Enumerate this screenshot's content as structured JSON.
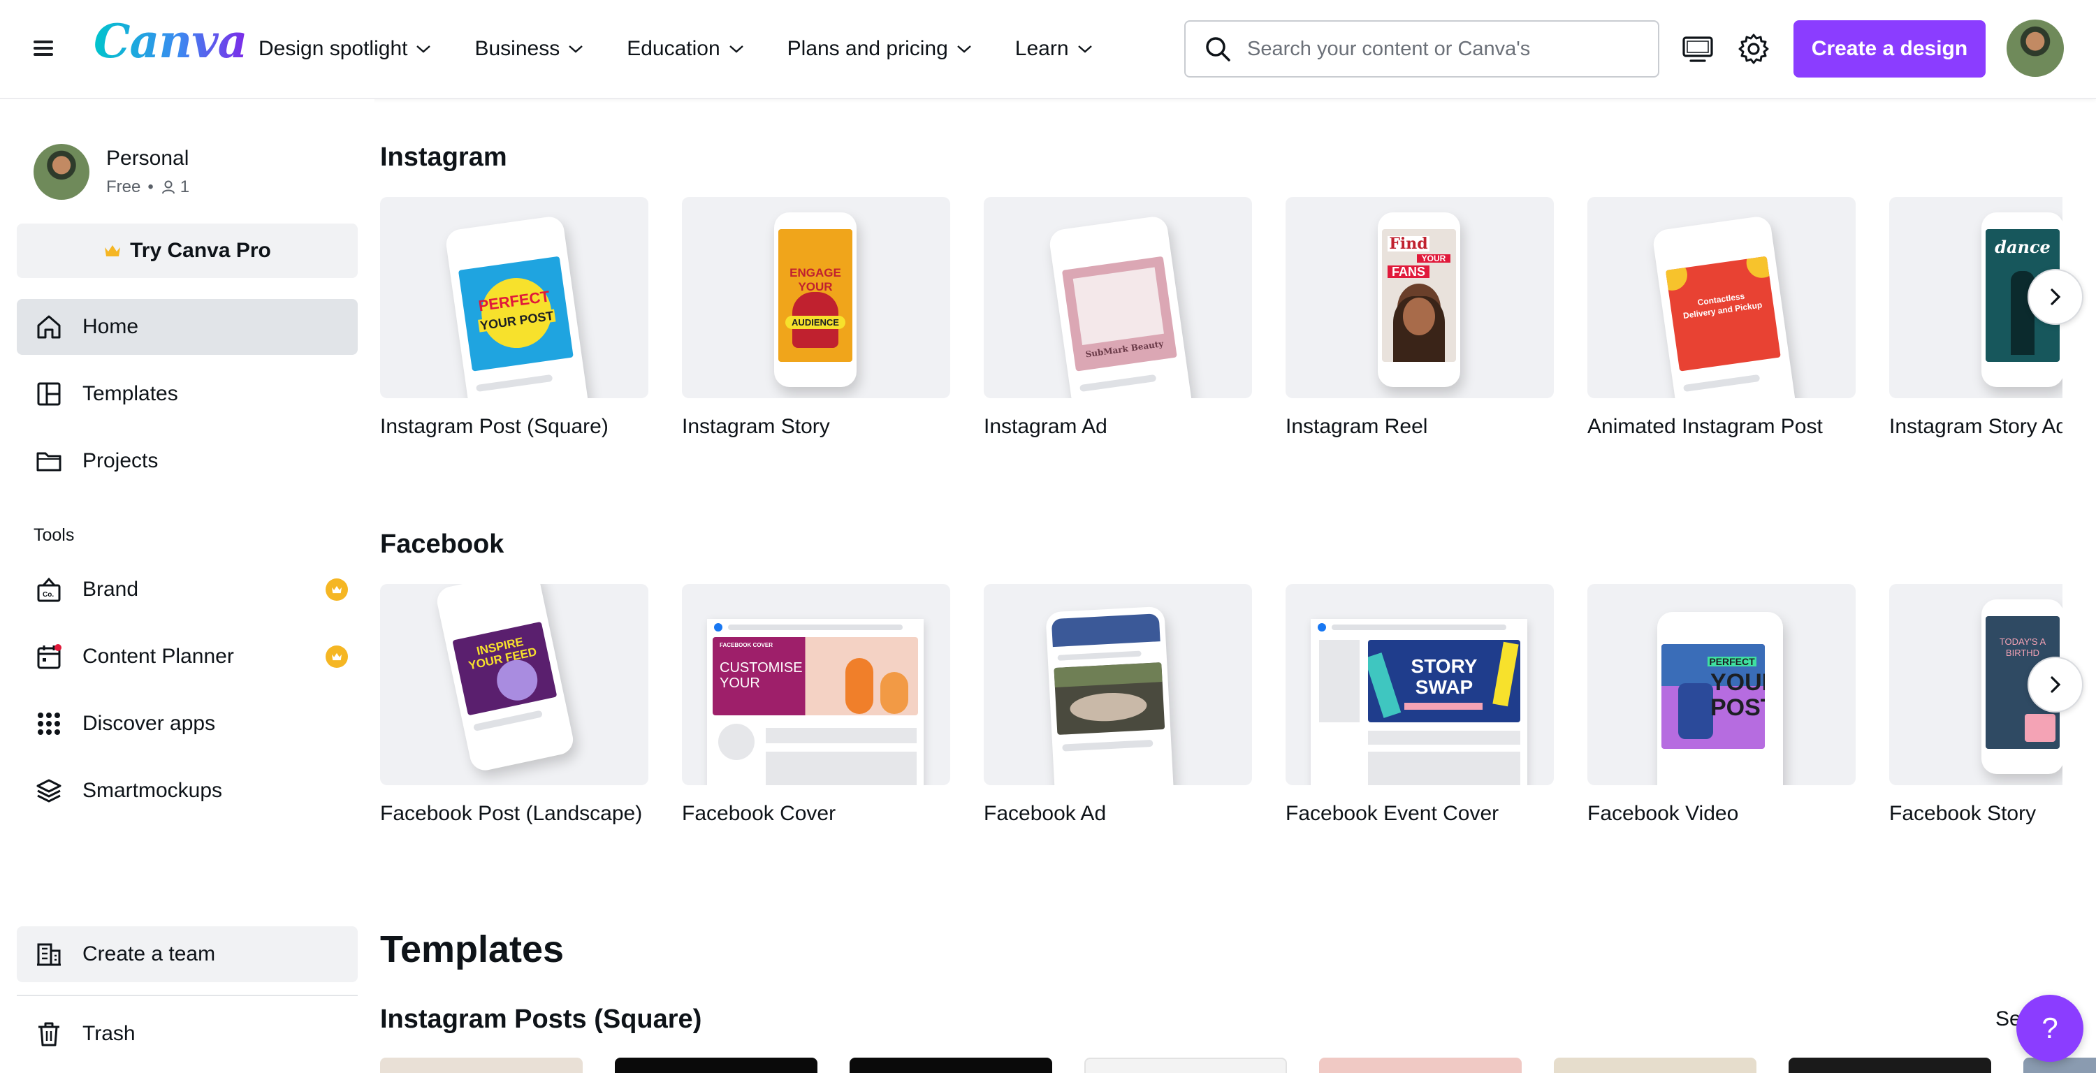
{
  "header": {
    "logo": "Canva",
    "nav": [
      "Design spotlight",
      "Business",
      "Education",
      "Plans and pricing",
      "Learn"
    ],
    "search_placeholder": "Search your content or Canva's",
    "create_button": "Create a design"
  },
  "sidebar": {
    "profile_name": "Personal",
    "profile_plan": "Free",
    "profile_members": "1",
    "try_pro": "Try Canva Pro",
    "nav": [
      {
        "label": "Home",
        "icon": "home-icon",
        "active": true
      },
      {
        "label": "Templates",
        "icon": "templates-icon"
      },
      {
        "label": "Projects",
        "icon": "folder-icon"
      }
    ],
    "tools_label": "Tools",
    "tools": [
      {
        "label": "Brand",
        "icon": "brand-icon",
        "pro": true
      },
      {
        "label": "Content Planner",
        "icon": "calendar-icon",
        "pro": true
      },
      {
        "label": "Discover apps",
        "icon": "apps-grid-icon"
      },
      {
        "label": "Smartmockups",
        "icon": "layers-icon"
      }
    ],
    "create_team": "Create a team",
    "trash": "Trash"
  },
  "main": {
    "instagram": {
      "title": "Instagram",
      "cards": [
        {
          "label": "Instagram Post (Square)",
          "art": [
            "PERFECT",
            "YOUR POST"
          ]
        },
        {
          "label": "Instagram Story",
          "art": [
            "ENGAGE",
            "YOUR",
            "AUDIENCE"
          ]
        },
        {
          "label": "Instagram Ad",
          "art": [
            "SubMark Beauty"
          ]
        },
        {
          "label": "Instagram Reel",
          "art": [
            "Find",
            "YOUR",
            "FANS"
          ]
        },
        {
          "label": "Animated Instagram Post",
          "art": [
            "Contactless",
            "Delivery and Pickup"
          ]
        },
        {
          "label": "Instagram Story Ad",
          "art": [
            "dance"
          ]
        }
      ]
    },
    "facebook": {
      "title": "Facebook",
      "cards": [
        {
          "label": "Facebook Post (Landscape)",
          "art": [
            "INSPIRE",
            "YOUR FEED"
          ]
        },
        {
          "label": "Facebook Cover",
          "art": [
            "FACEBOOK COVER",
            "CUSTOMISE",
            "YOUR"
          ]
        },
        {
          "label": "Facebook Ad",
          "art": []
        },
        {
          "label": "Facebook Event Cover",
          "art": [
            "STORY",
            "SWAP"
          ]
        },
        {
          "label": "Facebook Video",
          "art": [
            "PERFECT",
            "YOUR",
            "POST"
          ]
        },
        {
          "label": "Facebook Story",
          "art": [
            "TODAY'S A",
            "BIRTHD"
          ]
        }
      ]
    },
    "templates_title": "Templates",
    "templates_sub": "Instagram Posts (Square)",
    "see_all": "See all"
  },
  "colors": {
    "accent": "#8b3dff",
    "crown": "#f5b623",
    "active_bg": "#e1e4e8"
  }
}
